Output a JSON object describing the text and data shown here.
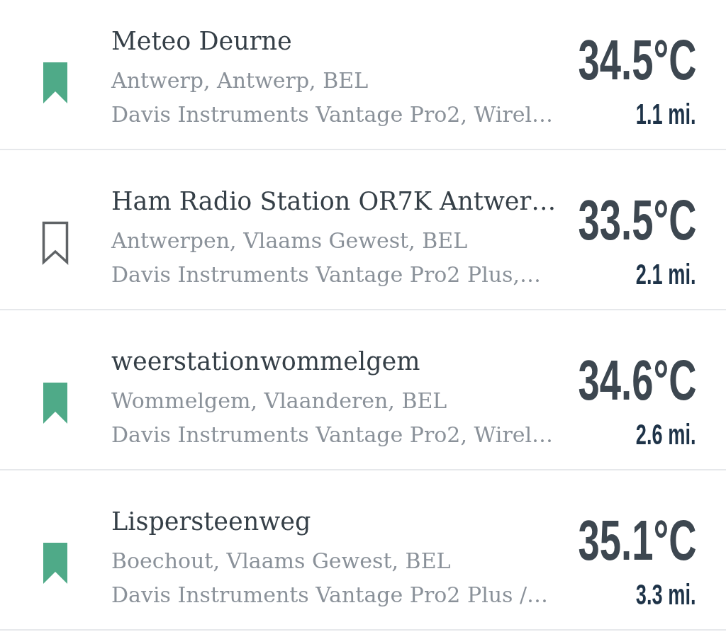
{
  "stations": [
    {
      "name": "Meteo Deurne",
      "location": "Antwerp, Antwerp, BEL",
      "hardware": "Davis Instruments Vantage Pro2, Wirel…",
      "temperature": "34.5°C",
      "distance": "1.1 mi.",
      "bookmarked": true
    },
    {
      "name": "Ham Radio Station OR7K Antwer…",
      "location": "Antwerpen, Vlaams Gewest, BEL",
      "hardware": "Davis Instruments Vantage Pro2 Plus,…",
      "temperature": "33.5°C",
      "distance": "2.1 mi.",
      "bookmarked": false
    },
    {
      "name": "weerstationwommelgem",
      "location": "Wommelgem, Vlaanderen, BEL",
      "hardware": "Davis Instruments Vantage Pro2, Wirel…",
      "temperature": "34.6°C",
      "distance": "2.6 mi.",
      "bookmarked": true
    },
    {
      "name": "Lispersteenweg",
      "location": "Boechout, Vlaams Gewest, BEL",
      "hardware": "Davis Instruments Vantage Pro2 Plus /…",
      "temperature": "35.1°C",
      "distance": "3.3 mi.",
      "bookmarked": true
    }
  ]
}
